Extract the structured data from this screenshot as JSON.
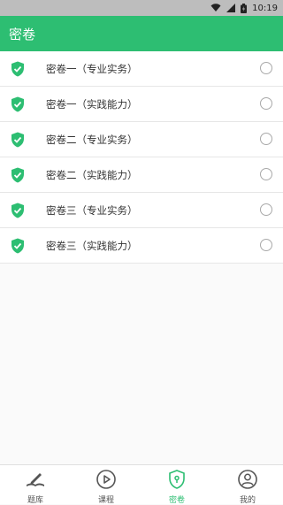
{
  "status_bar": {
    "time": "10:19"
  },
  "appbar": {
    "title": "密卷"
  },
  "list": [
    {
      "label": "密卷一（专业实务）"
    },
    {
      "label": "密卷一（实践能力）"
    },
    {
      "label": "密卷二（专业实务）"
    },
    {
      "label": "密卷二（实践能力）"
    },
    {
      "label": "密卷三（专业实务）"
    },
    {
      "label": "密卷三（实践能力）"
    }
  ],
  "bottom_nav": {
    "tabs": [
      {
        "label": "题库",
        "icon": "book-pen-icon"
      },
      {
        "label": "课程",
        "icon": "play-circle-icon"
      },
      {
        "label": "密卷",
        "icon": "shield-lock-icon",
        "active": true
      },
      {
        "label": "我的",
        "icon": "person-icon"
      }
    ]
  },
  "colors": {
    "brand": "#2dbe72",
    "text": "#333333"
  }
}
